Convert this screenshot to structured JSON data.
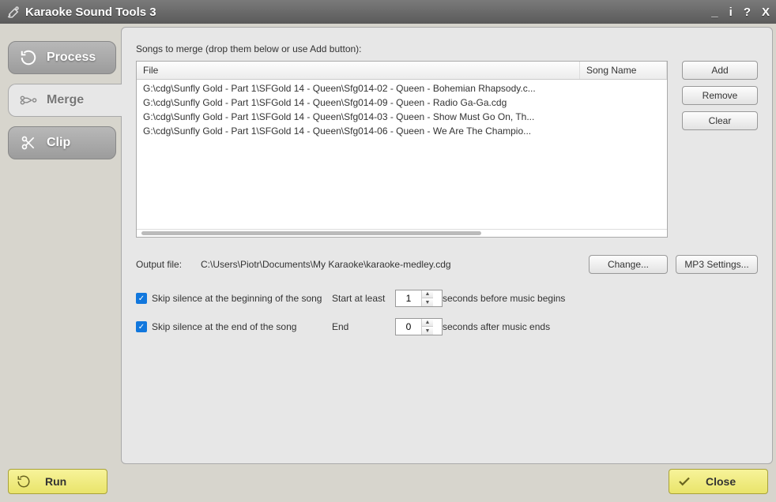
{
  "app": {
    "title": "Karaoke Sound Tools 3"
  },
  "window_controls": {
    "minimize": "_",
    "info": "i",
    "help": "?",
    "close": "X"
  },
  "tabs": {
    "process": "Process",
    "merge": "Merge",
    "clip": "Clip"
  },
  "panel": {
    "instruction": "Songs to merge (drop them below or use Add button):",
    "columns": {
      "file": "File",
      "song": "Song Name"
    },
    "rows": [
      {
        "file": "G:\\cdg\\Sunfly Gold - Part 1\\SFGold 14 - Queen\\Sfg014-02 - Queen - Bohemian Rhapsody.c...",
        "song": ""
      },
      {
        "file": "G:\\cdg\\Sunfly Gold - Part 1\\SFGold 14 - Queen\\Sfg014-09 - Queen - Radio Ga-Ga.cdg",
        "song": ""
      },
      {
        "file": "G:\\cdg\\Sunfly Gold - Part 1\\SFGold 14 - Queen\\Sfg014-03 - Queen - Show Must Go On, Th...",
        "song": ""
      },
      {
        "file": "G:\\cdg\\Sunfly Gold - Part 1\\SFGold 14 - Queen\\Sfg014-06 - Queen - We Are The Champio...",
        "song": ""
      }
    ],
    "buttons": {
      "add": "Add",
      "remove": "Remove",
      "clear": "Clear"
    },
    "output": {
      "label": "Output file:",
      "path": "C:\\Users\\Piotr\\Documents\\My Karaoke\\karaoke-medley.cdg",
      "change": "Change...",
      "mp3": "MP3 Settings..."
    },
    "options": {
      "skip_begin": "Skip silence at the beginning of the song",
      "skip_end": "Skip silence at the end of the song",
      "start_label": "Start at least",
      "start_value": "1",
      "start_suffix": "seconds before music begins",
      "end_label": "End",
      "end_value": "0",
      "end_suffix": "seconds after music ends"
    }
  },
  "footer": {
    "run": "Run",
    "close": "Close"
  }
}
